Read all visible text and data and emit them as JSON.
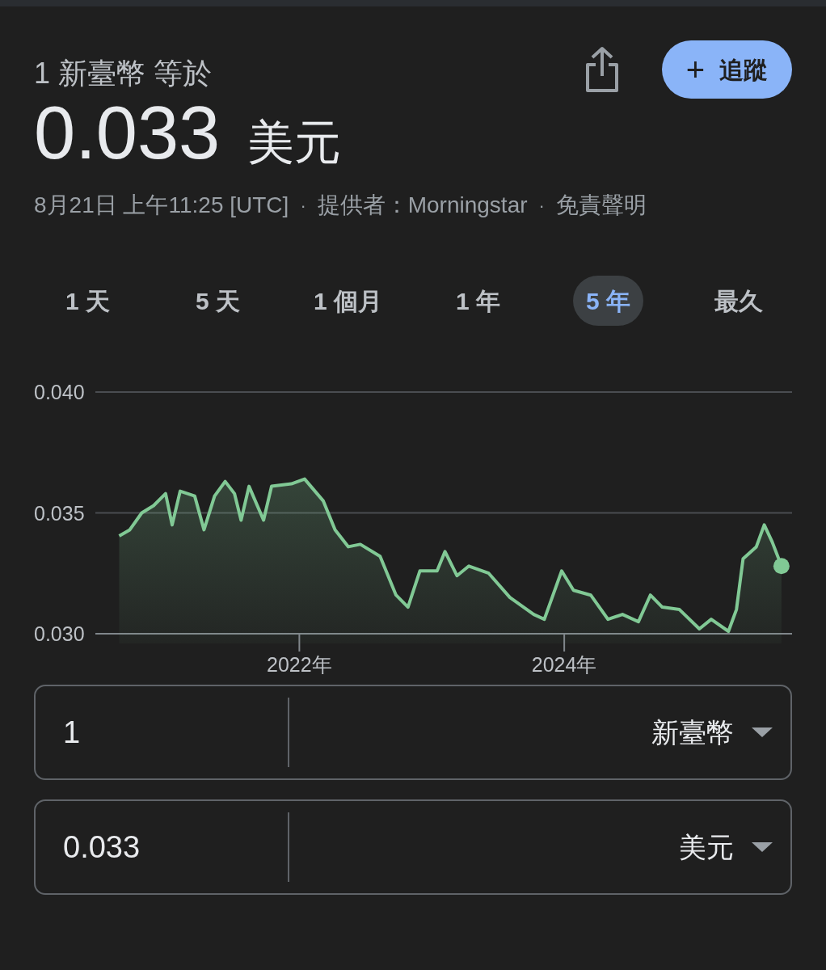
{
  "header": {
    "title": "1 新臺幣 等於",
    "follow_button": {
      "icon": "+",
      "label": "追蹤"
    }
  },
  "rate": {
    "value": "0.033",
    "unit": "美元"
  },
  "meta": [
    {
      "kind": "text",
      "text": "8月21日 上午11:25 [UTC]"
    },
    {
      "kind": "separator",
      "text": "·"
    },
    {
      "kind": "text",
      "text": "提供者：Morningstar"
    },
    {
      "kind": "separator",
      "text": "·"
    },
    {
      "kind": "link",
      "text": "免責聲明"
    }
  ],
  "tabs": [
    {
      "label": "1 天",
      "selected": false
    },
    {
      "label": "5 天",
      "selected": false
    },
    {
      "label": "1 個月",
      "selected": false
    },
    {
      "label": "1 年",
      "selected": false
    },
    {
      "label": "5 年",
      "selected": true
    },
    {
      "label": "最久",
      "selected": false
    }
  ],
  "chart_data": {
    "type": "area",
    "x": [
      2020.64,
      2020.72,
      2020.81,
      2020.9,
      2020.99,
      2021.04,
      2021.1,
      2021.21,
      2021.28,
      2021.36,
      2021.44,
      2021.51,
      2021.56,
      2021.62,
      2021.73,
      2021.79,
      2021.94,
      2022.04,
      2022.18,
      2022.27,
      2022.37,
      2022.46,
      2022.61,
      2022.73,
      2022.82,
      2022.91,
      2023.04,
      2023.1,
      2023.19,
      2023.28,
      2023.43,
      2023.59,
      2023.77,
      2023.85,
      2023.98,
      2024.07,
      2024.2,
      2024.33,
      2024.44,
      2024.56,
      2024.65,
      2024.74,
      2024.87,
      2025.02,
      2025.11,
      2025.24,
      2025.3,
      2025.35,
      2025.45,
      2025.51,
      2025.57,
      2025.64
    ],
    "series": [
      {
        "color": "#81c995",
        "values": [
          0.03405,
          0.0343,
          0.035,
          0.0353,
          0.0358,
          0.0345,
          0.0359,
          0.0357,
          0.0343,
          0.0357,
          0.0363,
          0.0358,
          0.0347,
          0.0361,
          0.0347,
          0.0361,
          0.0362,
          0.0364,
          0.0355,
          0.0343,
          0.0336,
          0.0337,
          0.0332,
          0.0316,
          0.0311,
          0.0326,
          0.0326,
          0.0334,
          0.0324,
          0.0328,
          0.0325,
          0.0315,
          0.0308,
          0.0306,
          0.0326,
          0.0318,
          0.0316,
          0.0306,
          0.0308,
          0.0305,
          0.0316,
          0.0311,
          0.031,
          0.0302,
          0.0306,
          0.0301,
          0.031,
          0.0331,
          0.0336,
          0.0345,
          0.0338,
          0.0328
        ]
      }
    ],
    "xlim": [
      2020.46,
      2025.72
    ],
    "ylim": [
      0.03,
      0.04
    ],
    "xticks": [
      {
        "value": 2022,
        "label": "2022年"
      },
      {
        "value": 2024,
        "label": "2024年"
      }
    ],
    "yticks": [
      {
        "value": 0.04,
        "label": "0.040"
      },
      {
        "value": 0.035,
        "label": "0.035"
      },
      {
        "value": 0.03,
        "label": "0.030"
      }
    ]
  },
  "converter": [
    {
      "amount": "1",
      "currency": "新臺幣"
    },
    {
      "amount": "0.033",
      "currency": "美元"
    }
  ]
}
